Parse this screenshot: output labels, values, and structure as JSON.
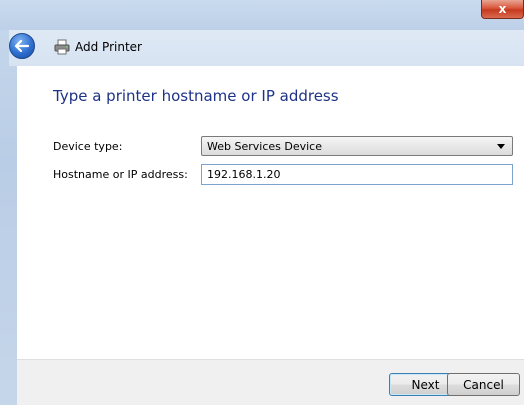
{
  "window": {
    "title": "Add Printer",
    "close_label": "x"
  },
  "page": {
    "instruction": "Type a printer hostname or IP address"
  },
  "form": {
    "device_type_label": "Device type:",
    "device_type_value": "Web Services Device",
    "hostname_label": "Hostname or IP address:",
    "hostname_value": "192.168.1.20"
  },
  "footer": {
    "next_label": "Next",
    "cancel_label": "Cancel"
  },
  "icons": {
    "back": "back-arrow-icon",
    "printer": "printer-icon",
    "dropdown": "chevron-down-icon",
    "close": "close-icon"
  },
  "colors": {
    "instruction_text": "#1e3287",
    "frame": "#c7d8ec",
    "close_button": "#d9573c"
  }
}
